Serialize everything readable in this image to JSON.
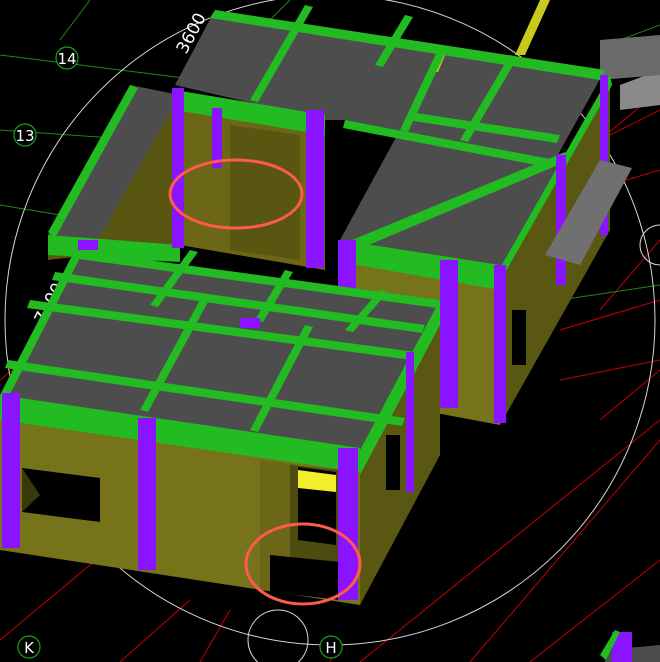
{
  "axes": {
    "row_labels": [
      "14",
      "13"
    ],
    "col_labels": [
      "K",
      "H"
    ]
  },
  "dimensions": {
    "top": "3600",
    "left": "7200"
  },
  "colors": {
    "background": "#000000",
    "grid_red": "#d40000",
    "grid_green": "#1a8c1a",
    "slab": "#4d4d4d",
    "beam": "#22bb22",
    "wall": "#77731a",
    "wall_dark": "#4e4b10",
    "column": "#8a14ff",
    "highlight_circle": "#ff5a4a",
    "window_light": "#f2ef2a",
    "axis_bubble_border": "#16a316"
  }
}
